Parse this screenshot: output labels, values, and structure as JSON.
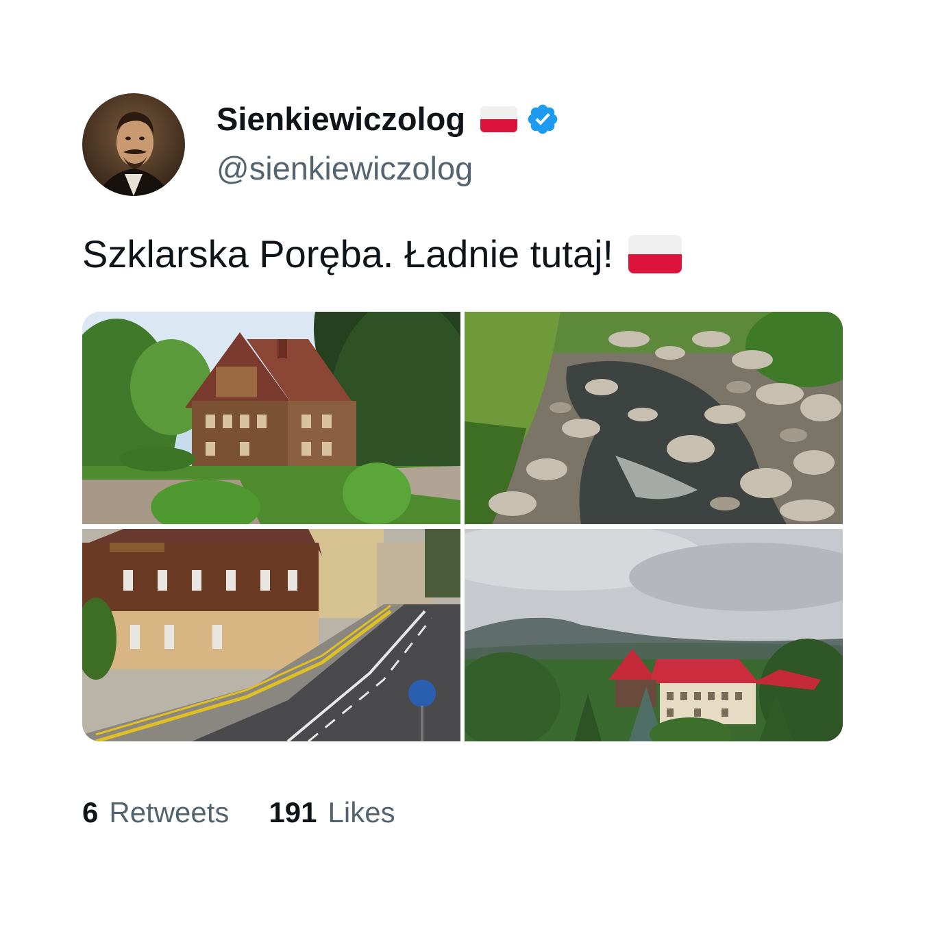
{
  "author": {
    "display_name": "Sienkiewiczolog",
    "handle": "@sienkiewiczolog",
    "verified": true,
    "name_emoji": "flag-poland-icon"
  },
  "tweet": {
    "text": "Szklarska Poręba. Ładnie tutaj!",
    "text_emoji": "flag-poland-icon"
  },
  "media": [
    {
      "name": "photo-wooden-villa"
    },
    {
      "name": "photo-rocky-river"
    },
    {
      "name": "photo-street-timber-house"
    },
    {
      "name": "photo-red-roof-buildings-mountains"
    }
  ],
  "stats": {
    "retweets_count": "6",
    "retweets_label": "Retweets",
    "likes_count": "191",
    "likes_label": "Likes"
  },
  "colors": {
    "text_primary": "#0f1419",
    "text_secondary": "#536471",
    "verified_blue": "#1d9bf0",
    "flag_red": "#dc143c"
  }
}
